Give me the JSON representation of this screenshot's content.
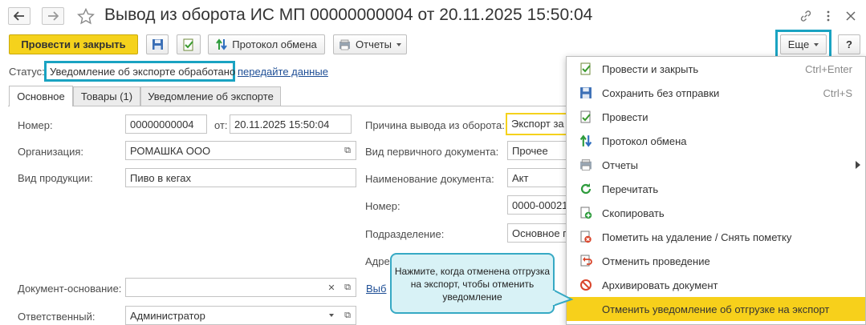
{
  "window": {
    "title": "Вывод из оборота ИС МП 00000000004 от 20.11.2025 15:50:04"
  },
  "toolbar": {
    "post_close": "Провести и закрыть",
    "exchange_log": "Протокол обмена",
    "reports": "Отчеты",
    "more": "Еще",
    "help": "?"
  },
  "status": {
    "label": "Статус:",
    "value": "Уведомление об экспорте обработано",
    "link": "передайте данные"
  },
  "tabs": [
    "Основное",
    "Товары (1)",
    "Уведомление об экспорте"
  ],
  "form": {
    "number_label": "Номер:",
    "number_value": "00000000004",
    "date_label": "от:",
    "date_value": "20.11.2025 15:50:04",
    "org_label": "Организация:",
    "org_value": "РОМАШКА ООО",
    "product_label": "Вид продукции:",
    "product_value": "Пиво в кегах",
    "basis_label": "Документ-основание:",
    "basis_value": "",
    "responsible_label": "Ответственный:",
    "responsible_value": "Администратор"
  },
  "right_form": {
    "reason_label": "Причина вывода из оборота:",
    "reason_value": "Экспорт за",
    "primary_doc_label": "Вид первичного документа:",
    "primary_doc_value": "Прочее",
    "doc_name_label": "Наименование документа:",
    "doc_name_value": "Акт",
    "number_label": "Номер:",
    "number_value": "0000-00021",
    "dept_label": "Подразделение:",
    "dept_value": "Основное п",
    "addr_label": "Адре",
    "choose_link": "Выб"
  },
  "menu": {
    "items": [
      {
        "label": "Провести и закрыть",
        "shortcut": "Ctrl+Enter",
        "icon": "post-close-icon"
      },
      {
        "label": "Сохранить без отправки",
        "shortcut": "Ctrl+S",
        "icon": "save-icon"
      },
      {
        "label": "Провести",
        "shortcut": "",
        "icon": "post-icon"
      },
      {
        "label": "Протокол обмена",
        "shortcut": "",
        "icon": "exchange-icon"
      },
      {
        "label": "Отчеты",
        "shortcut": "",
        "icon": "reports-icon"
      },
      {
        "label": "Перечитать",
        "shortcut": "",
        "icon": "reload-icon"
      },
      {
        "label": "Скопировать",
        "shortcut": "",
        "icon": "copy-icon"
      },
      {
        "label": "Пометить на удаление / Снять пометку",
        "shortcut": "",
        "icon": "delete-mark-icon"
      },
      {
        "label": "Отменить проведение",
        "shortcut": "",
        "icon": "undo-post-icon"
      },
      {
        "label": "Архивировать документ",
        "shortcut": "",
        "icon": "archive-icon"
      },
      {
        "label": "Отменить уведомление об отгрузке на экспорт",
        "shortcut": "",
        "icon": ""
      }
    ]
  },
  "tooltip": {
    "text": "Нажмите, когда отменена отгрузка на экспорт, чтобы отменить уведомление"
  },
  "colors": {
    "accent_yellow": "#f5d21c",
    "highlight_cyan": "#1aa3c2",
    "tooltip_bg": "#d8f2f6"
  }
}
